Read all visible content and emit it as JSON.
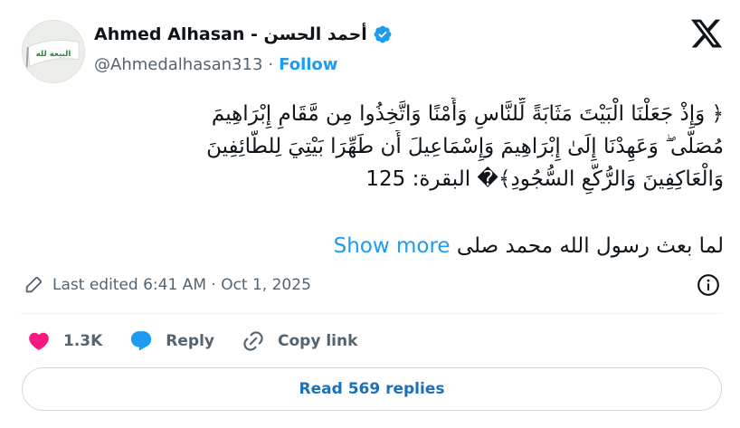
{
  "author": {
    "display_name": "Ahmed Alhasan - أحمد الحسن",
    "handle": "@Ahmedalhasan313",
    "separator": "·",
    "follow_label": "Follow",
    "avatar_banner_text": "البيعة لله",
    "verified_color": "#1d9bf0"
  },
  "brand": {
    "logo_icon": "x-logo-icon"
  },
  "tweet": {
    "lines": [
      "﴿ وَإِذْ جَعَلْنَا الْبَيْتَ مَثَابَةً لِّلنَّاسِ وَأَمْنًا وَاتَّخِذُوا مِن مَّقَامِ إِبْرَاهِيمَ",
      "مُصَلًّى ۖ وَعَهِدْنَا إِلَىٰ إِبْرَاهِيمَ وَإِسْمَاعِيلَ أَن طَهِّرَا بَيْتِيَ لِلطَّائِفِينَ",
      "وَالْعَاكِفِينَ وَالرُّكَّعِ السُّجُودِ﴾� البقرة: 125"
    ],
    "preview_text": "لما بعث رسول الله محمد صلى",
    "show_more_label": "Show more",
    "link_color": "#1d9bf0"
  },
  "meta": {
    "edited_label": "Last edited 6:41 AM · Oct 1, 2025"
  },
  "actions": {
    "like_count": "1.3K",
    "reply_label": "Reply",
    "copy_link_label": "Copy link",
    "like_color": "#f91880"
  },
  "replies": {
    "read_label": "Read 569 replies"
  }
}
